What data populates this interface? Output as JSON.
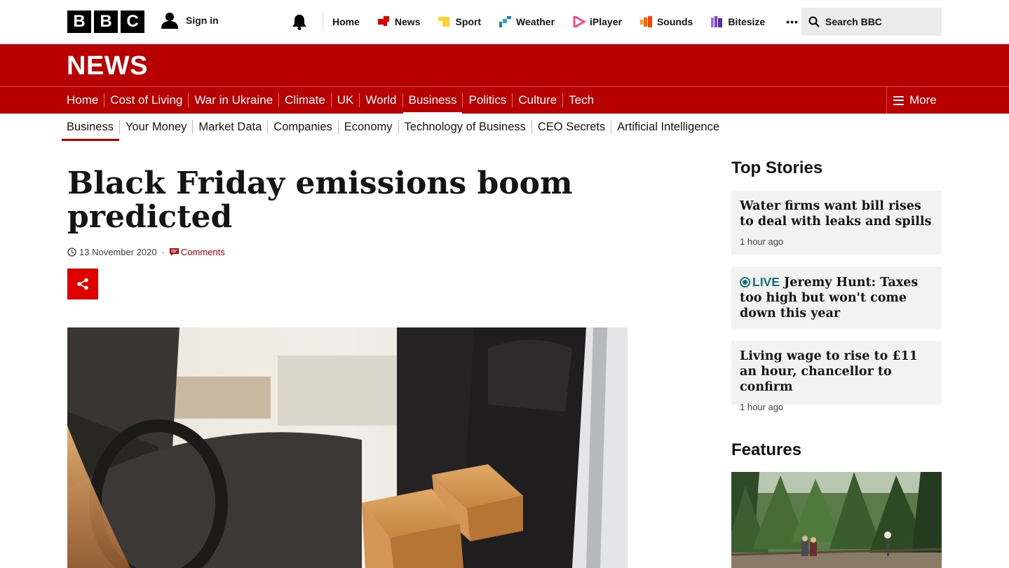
{
  "brand": {
    "logo_letters": [
      "B",
      "B",
      "C"
    ],
    "sign_in": "Sign in"
  },
  "topnav": [
    {
      "label": "Home",
      "icon": "none"
    },
    {
      "label": "News",
      "icon": "news-icon",
      "color": "#e00000"
    },
    {
      "label": "Sport",
      "icon": "sport-icon",
      "color": "#ffd230"
    },
    {
      "label": "Weather",
      "icon": "weather-icon",
      "color": "#1a7fc0"
    },
    {
      "label": "iPlayer",
      "icon": "iplayer-icon",
      "color": "#f54997"
    },
    {
      "label": "Sounds",
      "icon": "sounds-icon",
      "color": "#ff6600"
    },
    {
      "label": "Bitesize",
      "icon": "bitesize-icon",
      "color": "#7d3cd1"
    }
  ],
  "more_dots": "•••",
  "search": {
    "placeholder": "Search BBC"
  },
  "news_banner": "NEWS",
  "section_nav": [
    "Home",
    "Cost of Living",
    "War in Ukraine",
    "Climate",
    "UK",
    "World",
    "Business",
    "Politics",
    "Culture",
    "Tech"
  ],
  "section_nav_active": "Business",
  "section_more": "More",
  "sub_nav": [
    "Business",
    "Your Money",
    "Market Data",
    "Companies",
    "Economy",
    "Technology of Business",
    "CEO Secrets",
    "Artificial Intelligence"
  ],
  "sub_nav_active": "Business",
  "article": {
    "headline": "Black Friday emissions boom predicted",
    "date": "13 November 2020",
    "separator": "·",
    "comments": "Comments"
  },
  "sidebar": {
    "top_stories_heading": "Top Stories",
    "stories": [
      {
        "title": "Water firms want bill rises to deal with leaks and spills",
        "time": "1 hour ago",
        "live": false
      },
      {
        "live_label": "LIVE",
        "title": "Jeremy Hunt: Taxes too high but won't come down this year",
        "live": true
      },
      {
        "title": "Living wage to rise to £11 an hour, chancellor to confirm",
        "time": "1 hour ago",
        "live": false
      }
    ],
    "features_heading": "Features"
  },
  "colors": {
    "bbc_red": "#b80000",
    "share_red": "#e00000",
    "live_teal": "#147272"
  }
}
